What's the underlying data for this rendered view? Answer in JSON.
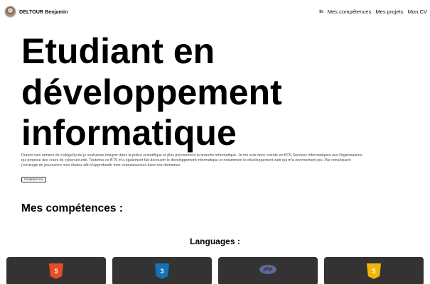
{
  "navbar": {
    "brand_name": "DELTOUR Benjamin",
    "linkedin_label": "in",
    "links": [
      "Mes compétences",
      "Mes projets",
      "Mon CV"
    ]
  },
  "hero": {
    "title_lines": [
      "Etudiant en",
      "développement",
      "informatique"
    ],
    "description_lines": [
      "Durant mes années de collège/lycée je souhaitais intégrer dans la police scientifique et plus précisément la branche informatique. Je me suis donc orienté en BTS Services Informatiques aux Organisations",
      "qui propose des cours de cybersécurité. Toutefois ce BTS m'a également fait découvrir le développement informatique et notamment le développement web qui m'a énormement plu. Par conséquent",
      "j'envisage de poursuivre mes études afin d'approfondir mes connaissances dans ces domaines."
    ],
    "contact_button": "Contactez moi"
  },
  "skills": {
    "title": "Mes compétences :",
    "languages_title": "Languages :",
    "cards": [
      {
        "icon": "html5-icon",
        "glyph": "5",
        "color": "#e44d26"
      },
      {
        "icon": "css3-icon",
        "glyph": "3",
        "color": "#1572b6"
      },
      {
        "icon": "php-icon",
        "glyph": "php",
        "color": "#5f6a9c"
      },
      {
        "icon": "javascript-icon",
        "glyph": "5",
        "color": "#f0b70b"
      }
    ]
  },
  "colors": {
    "card_background": "#333333",
    "text": "#111111",
    "description_text": "#4a4a4a"
  }
}
